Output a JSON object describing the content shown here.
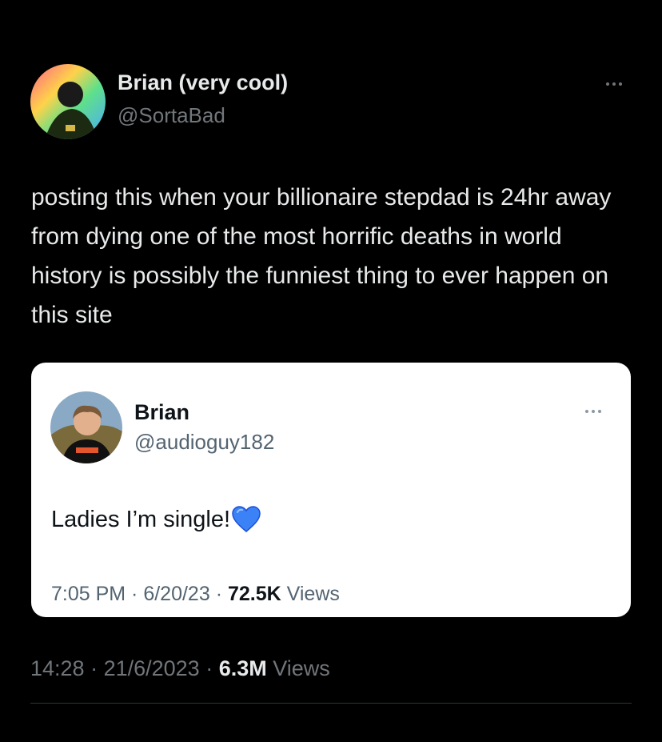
{
  "tweet": {
    "author_name": "Brian (very cool)",
    "author_handle": "@SortaBad",
    "text": "posting this when your billionaire stepdad is 24hr away from dying one of the most horrific deaths in world history is possibly the funniest thing to ever happen on this site",
    "time": "14:28",
    "date": "21/6/2023",
    "views_count": "6.3M",
    "views_label": "Views",
    "separator": " · "
  },
  "quoted_tweet": {
    "author_name": "Brian",
    "author_handle": "@audioguy182",
    "text": "Ladies I’m single!",
    "emoji_icon": "blue-heart-icon",
    "time": "7:05 PM",
    "date": "6/20/23",
    "views_count": "72.5K",
    "views_label": "Views",
    "separator": " · "
  },
  "colors": {
    "background": "#000000",
    "card_background": "#ffffff",
    "primary_text_dark": "#e7e9ea",
    "secondary_text": "#71767b",
    "heart_blue": "#2f80ed"
  }
}
